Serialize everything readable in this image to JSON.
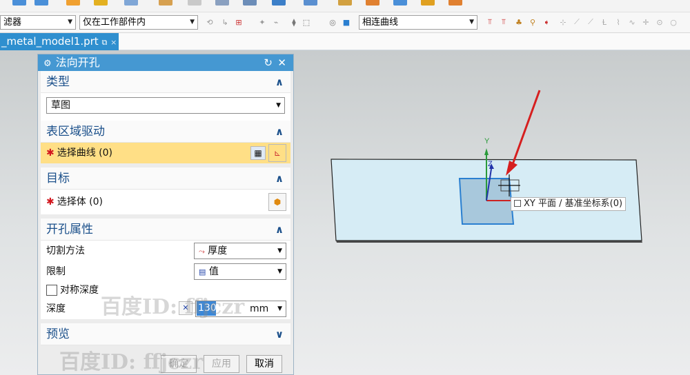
{
  "toolbar": {
    "filter_label": "滤器",
    "scope_value": "仅在工作部件内",
    "curve_rule_value": "相连曲线"
  },
  "tab": {
    "title": "_metal_model1.prt",
    "close_glyph": "×",
    "pin_glyph": "⧉"
  },
  "dialog": {
    "title": "法向开孔",
    "reset_glyph": "↻",
    "close_glyph": "✕",
    "sections": {
      "type": {
        "header": "类型",
        "value": "草图"
      },
      "region": {
        "header": "表区域驱动",
        "select_curve": "选择曲线 (0)"
      },
      "target": {
        "header": "目标",
        "select_body": "选择体 (0)"
      },
      "props": {
        "header": "开孔属性",
        "cut_method_label": "切割方法",
        "cut_method_value": "厚度",
        "limit_label": "限制",
        "limit_value": "值",
        "symmetric_label": "对称深度",
        "depth_label": "深度",
        "depth_value": "130",
        "depth_unit": "mm"
      },
      "preview": {
        "header": "预览"
      }
    },
    "buttons": {
      "ok": "确定",
      "apply": "应用",
      "cancel": "取消"
    }
  },
  "viewport": {
    "tooltip": "XY 平面 / 基准坐标系(0)",
    "axis_y": "Y",
    "axis_z": "Z"
  },
  "watermark": {
    "line1": "百度ID: ffjczr",
    "line2": "百度ID: ffjczr"
  },
  "colors": {
    "accent": "#4598d2",
    "highlight": "#ffdf86",
    "arrow": "#d61f1f"
  }
}
